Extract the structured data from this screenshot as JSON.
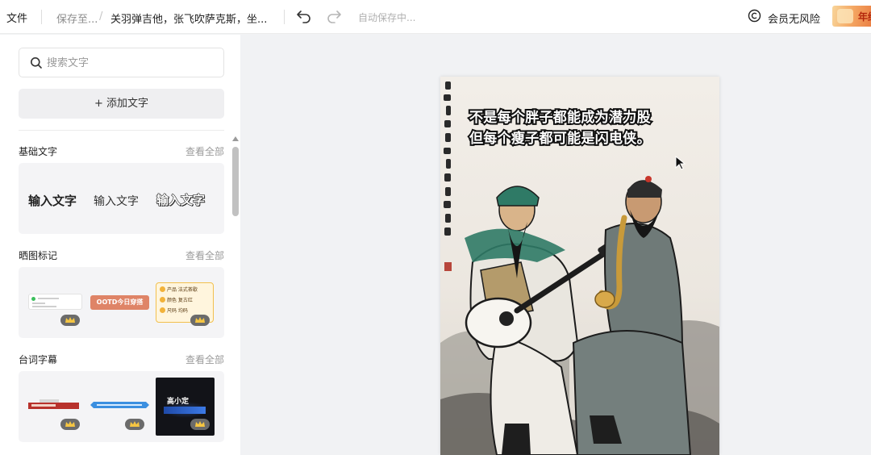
{
  "topbar": {
    "file_label": "文件",
    "save_to_label": "保存至...",
    "path_separator": "/",
    "document_title": "关羽弹吉他，张飞吹萨克斯，坐...",
    "autosave_status": "自动保存中...",
    "member_label": "会员无风险",
    "promo_banner_text": "年终",
    "icons": {
      "undo": "undo-icon",
      "redo": "redo-icon",
      "member": "copyright-icon"
    }
  },
  "panel": {
    "search": {
      "placeholder": "搜索文字",
      "value": ""
    },
    "add_text_label": "+ 添加文字",
    "sections": [
      {
        "title": "基础文字",
        "more": "查看全部",
        "items": [
          "输入文字",
          "输入文字",
          "输入文字"
        ]
      },
      {
        "title": "晒图标记",
        "more": "查看全部",
        "items": [
          {
            "kind": "chat-card"
          },
          {
            "kind": "banner",
            "text": "OOTD今日穿搭"
          },
          {
            "kind": "checklist",
            "rows": [
              "产品 法式茶歇",
              "颜色 复古红",
              "尺码 均码"
            ]
          }
        ]
      },
      {
        "title": "台词字幕",
        "more": "查看全部",
        "items": [
          {
            "kind": "subtitle-red",
            "text": "网店主理人"
          },
          {
            "kind": "subtitle-blue"
          },
          {
            "kind": "subtitle-dark",
            "text": "高小定"
          }
        ]
      }
    ]
  },
  "canvas": {
    "caption_lines": [
      "不是每个胖子都能成为潜力股",
      "但每个瘦子都可能是闪电侠。"
    ],
    "colors": {
      "paper": "#efebe5",
      "ink": "#1c1c1c",
      "green_cap": "#2f7a66",
      "robe_grey": "#6f7a78"
    }
  }
}
